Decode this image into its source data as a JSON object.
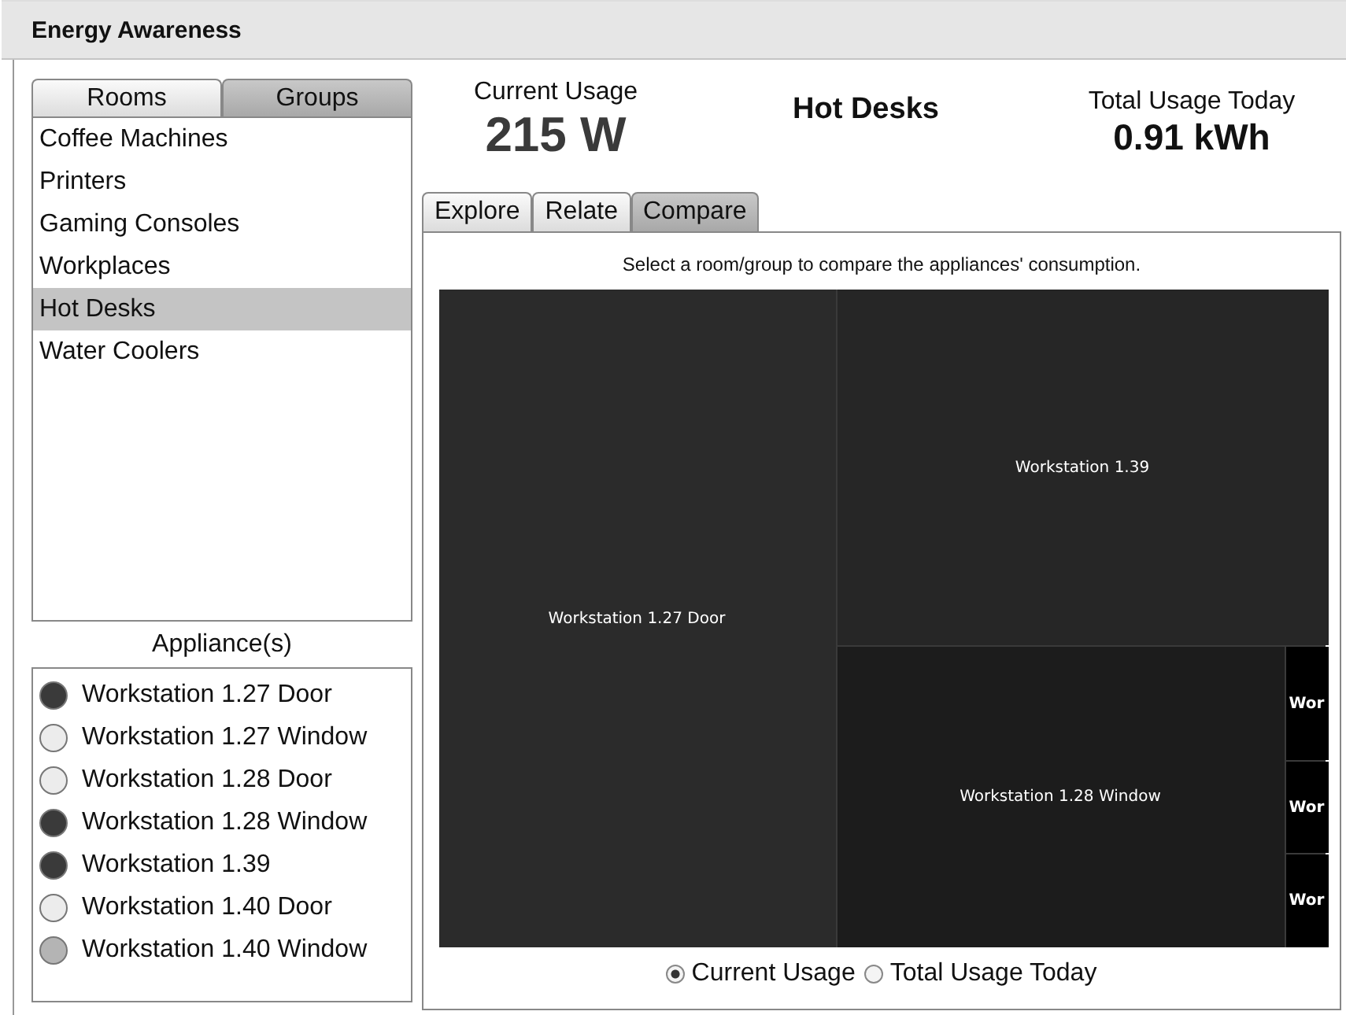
{
  "window": {
    "title": "Energy Awareness"
  },
  "source_tabs": [
    {
      "label": "Rooms",
      "selected": false
    },
    {
      "label": "Groups",
      "selected": true
    }
  ],
  "groups": [
    {
      "label": "Coffee Machines",
      "selected": false
    },
    {
      "label": "Printers",
      "selected": false
    },
    {
      "label": "Gaming Consoles",
      "selected": false
    },
    {
      "label": "Workplaces",
      "selected": false
    },
    {
      "label": "Hot Desks",
      "selected": true
    },
    {
      "label": "Water Coolers",
      "selected": false
    }
  ],
  "appliances_heading": "Appliance(s)",
  "appliances": [
    {
      "label": "Workstation 1.27 Door",
      "color": "#3a3a3a"
    },
    {
      "label": "Workstation 1.27 Window",
      "color": "#ececec"
    },
    {
      "label": "Workstation 1.28 Door",
      "color": "#ececec"
    },
    {
      "label": "Workstation 1.28 Window",
      "color": "#3a3a3a"
    },
    {
      "label": "Workstation 1.39",
      "color": "#3a3a3a"
    },
    {
      "label": "Workstation 1.40 Door",
      "color": "#ececec"
    },
    {
      "label": "Workstation 1.40 Window",
      "color": "#b4b4b4"
    }
  ],
  "current_usage": {
    "label": "Current Usage",
    "value": "215 W"
  },
  "selection": "Hot Desks",
  "total_usage": {
    "label": "Total Usage Today",
    "value": "0.91 kWh"
  },
  "view_tabs": [
    {
      "label": "Explore",
      "selected": false
    },
    {
      "label": "Relate",
      "selected": false
    },
    {
      "label": "Compare",
      "selected": true
    }
  ],
  "instruction": "Select a room/group to compare the appliances' consumption.",
  "treemap": [
    {
      "label": "Workstation 1.27 Door",
      "color": "#2b2b2b"
    },
    {
      "label": "Workstation 1.39",
      "color": "#262626"
    },
    {
      "label": "Workstation 1.28 Window",
      "color": "#1c1c1c"
    },
    {
      "label": "Wor",
      "color": "#000000"
    },
    {
      "label": "Wor",
      "color": "#000000"
    },
    {
      "label": "Wor",
      "color": "#000000"
    }
  ],
  "metric_options": [
    {
      "label": "Current Usage",
      "selected": true
    },
    {
      "label": "Total Usage Today",
      "selected": false
    }
  ]
}
